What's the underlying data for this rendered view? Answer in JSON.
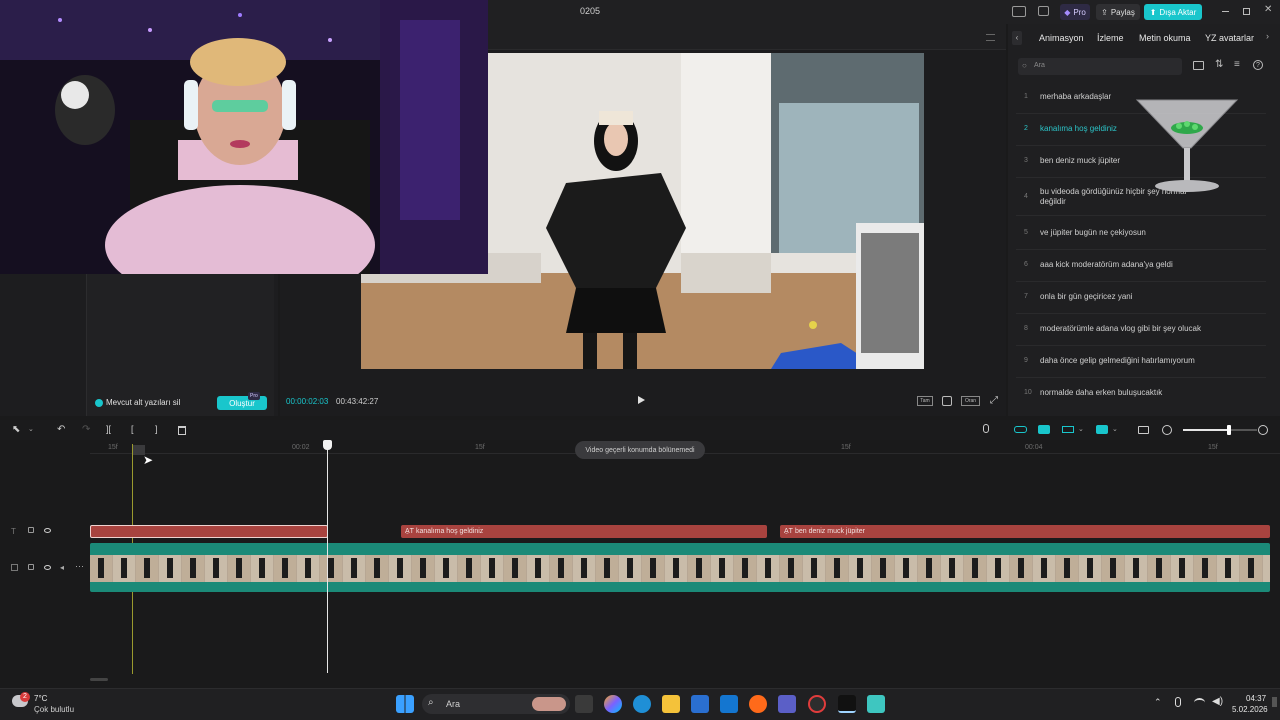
{
  "app": {
    "project_title": "0205",
    "pro_label": "Pro",
    "share_label": "Paylaş",
    "export_label": "Dışa Aktar"
  },
  "right_panel": {
    "tabs": [
      "Animasyon",
      "İzleme",
      "Metin okuma",
      "YZ avatarlar"
    ],
    "search_placeholder": "Ara",
    "captions": [
      {
        "num": "1",
        "text": "merhaba arkadaşlar"
      },
      {
        "num": "2",
        "text": "kanalıma hoş geldiniz"
      },
      {
        "num": "3",
        "text": "ben deniz muck jüpiter"
      },
      {
        "num": "4",
        "text": "bu videoda gördüğünüz hiçbir şey normal değildir"
      },
      {
        "num": "5",
        "text": "ve jüpiter bugün ne çekiyosun"
      },
      {
        "num": "6",
        "text": "aaa kick moderatörüm adana'ya geldi"
      },
      {
        "num": "7",
        "text": "onla bir gün geçiricez yani"
      },
      {
        "num": "8",
        "text": "moderatörümle adana vlog gibi bir şey olucak"
      },
      {
        "num": "9",
        "text": "daha önce gelip gelmediğini hatırlamıyorum"
      },
      {
        "num": "10",
        "text": "normalde daha erken buluşucaktık"
      }
    ],
    "active_caption_color": "#2cc4c8"
  },
  "left_panel": {
    "checkbox_label": "Mevcut alt yazıları sil",
    "create_button": "Oluştur",
    "pro_badge": "Pro"
  },
  "player": {
    "current_time": "00:00:02:03",
    "total_time": "00:43:42:27",
    "full_label": "Tam",
    "ratio_label": "Oran"
  },
  "timeline": {
    "ruler": [
      "15f",
      "00:02",
      "15f",
      "15f",
      "00:04",
      "15f"
    ],
    "tooltip": "Video geçerli konumda bölünemedi",
    "clips": [
      "kanalıma hoş geldiniz",
      "ben deniz muck jüpiter"
    ],
    "clip_prefix": "A̱T"
  },
  "taskbar": {
    "temp": "7°C",
    "weather": "Çok bulutlu",
    "search": "Ara",
    "time": "04:37",
    "date": "5.02.2026",
    "badge": "2"
  },
  "colors": {
    "accent": "#19c6cc",
    "clip_red": "#a8433f",
    "video_track": "#1b8a78"
  }
}
